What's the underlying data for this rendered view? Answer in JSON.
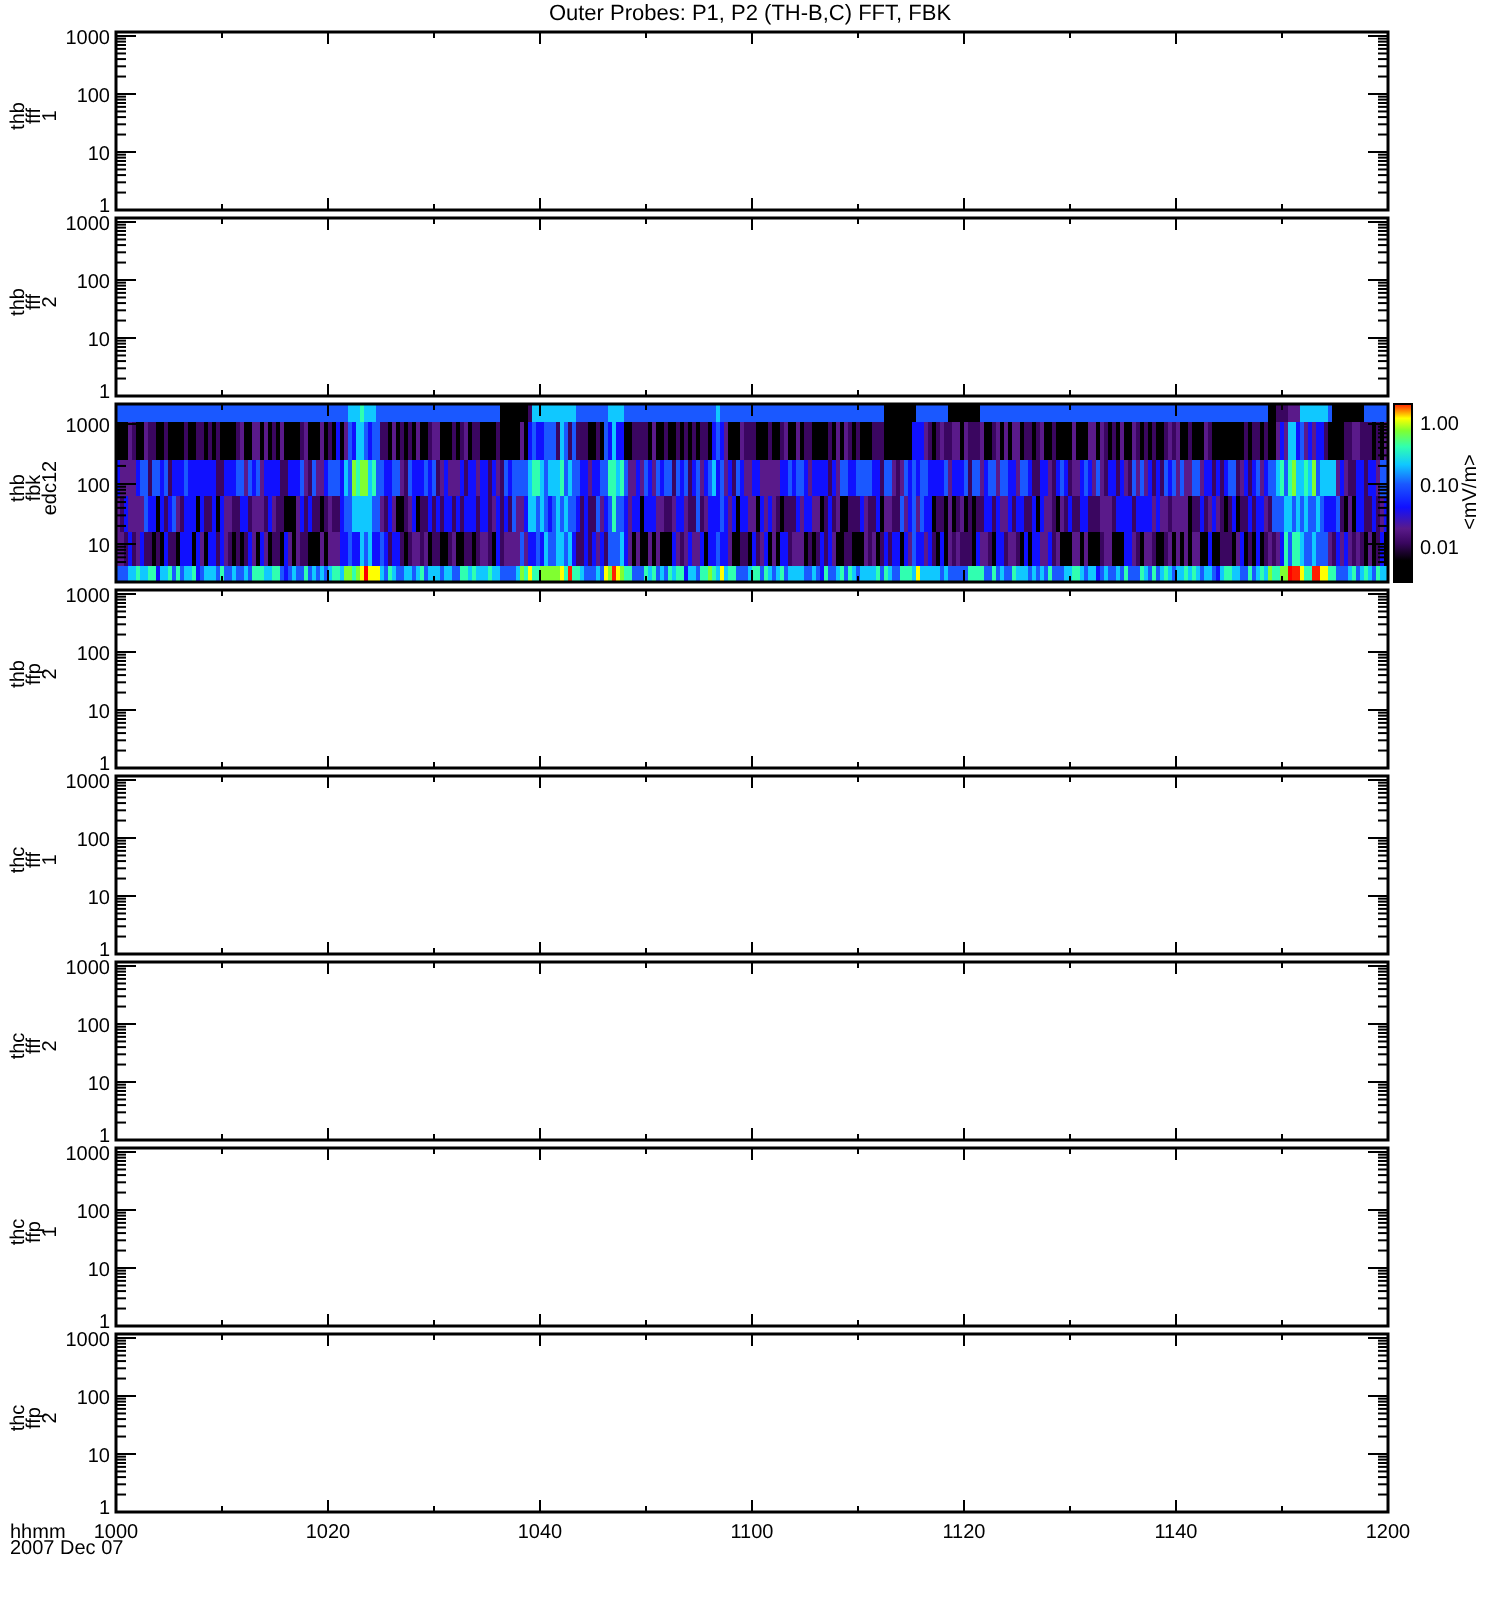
{
  "title": "Outer Probes: P1, P2 (TH-B,C) FFT, FBK",
  "panels": [
    {
      "kind": "empty",
      "label_lines": [
        "thb",
        "fff",
        "1"
      ],
      "yticks": [
        "1000",
        "100",
        "10",
        "1"
      ]
    },
    {
      "kind": "empty",
      "label_lines": [
        "thb",
        "fff",
        "2"
      ],
      "yticks": [
        "1000",
        "100",
        "10",
        "1"
      ]
    },
    {
      "kind": "spectrogram",
      "label_lines": [
        "thb",
        "fbk",
        "edc12"
      ],
      "yticks": [
        "1000",
        "100",
        "10"
      ],
      "colorbar": {
        "label": "<mV/m>",
        "ticks": [
          "1.00",
          "0.10",
          "0.01"
        ]
      }
    },
    {
      "kind": "empty",
      "label_lines": [
        "thb",
        "ffp",
        "2"
      ],
      "yticks": [
        "1000",
        "100",
        "10",
        "1"
      ]
    },
    {
      "kind": "empty",
      "label_lines": [
        "thc",
        "fff",
        "1"
      ],
      "yticks": [
        "1000",
        "100",
        "10",
        "1"
      ]
    },
    {
      "kind": "empty",
      "label_lines": [
        "thc",
        "fff",
        "2"
      ],
      "yticks": [
        "1000",
        "100",
        "10",
        "1"
      ]
    },
    {
      "kind": "empty",
      "label_lines": [
        "thc",
        "ffp",
        "1"
      ],
      "yticks": [
        "1000",
        "100",
        "10",
        "1"
      ]
    },
    {
      "kind": "empty",
      "label_lines": [
        "thc",
        "ffp",
        "2"
      ],
      "yticks": [
        "1000",
        "100",
        "10",
        "1"
      ]
    }
  ],
  "xaxis": {
    "label_lines": [
      "hhmm",
      "2007 Dec 07"
    ],
    "ticks": [
      "1000",
      "1020",
      "1040",
      "1100",
      "1120",
      "1140",
      "1200"
    ]
  }
}
